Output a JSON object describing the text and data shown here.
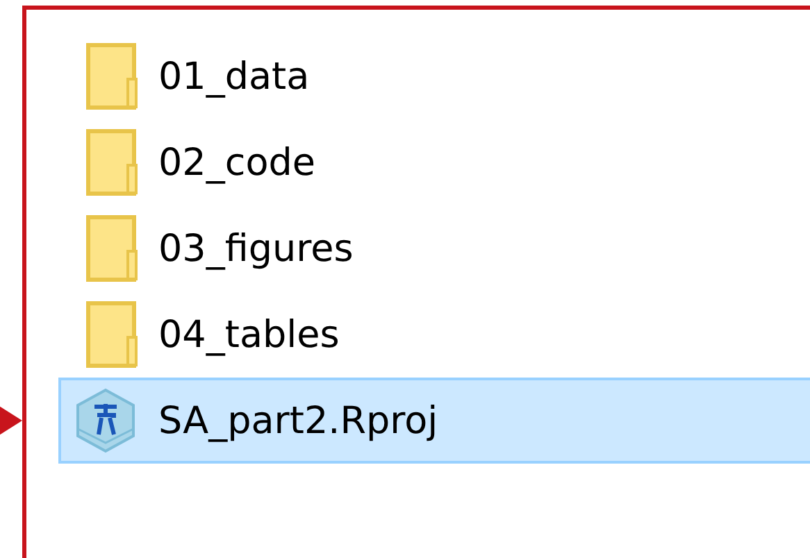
{
  "files": [
    {
      "name": "01_data",
      "kind": "folder",
      "selected": false,
      "pointed": false
    },
    {
      "name": "02_code",
      "kind": "folder",
      "selected": false,
      "pointed": false
    },
    {
      "name": "03_figures",
      "kind": "folder",
      "selected": false,
      "pointed": false
    },
    {
      "name": "04_tables",
      "kind": "folder",
      "selected": false,
      "pointed": false
    },
    {
      "name": "SA_part2.Rproj",
      "kind": "rproject",
      "selected": true,
      "pointed": true
    }
  ]
}
